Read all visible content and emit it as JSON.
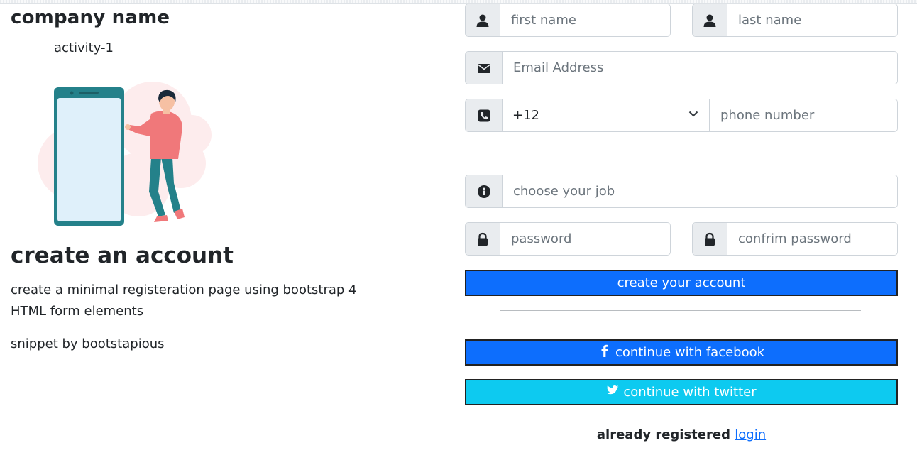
{
  "brand": {
    "company_name": "company name",
    "activity": "activity-1"
  },
  "intro": {
    "heading": "create an account",
    "description": "create a minimal registeration page using bootstrap 4 HTML form elements",
    "credit": "snippet by bootstapious"
  },
  "form": {
    "first_name": {
      "placeholder": "first name",
      "icon": "user-icon"
    },
    "last_name": {
      "placeholder": "last name",
      "icon": "user-icon"
    },
    "email": {
      "placeholder": "Email Address",
      "icon": "envelope-icon"
    },
    "phone": {
      "country_code": "+12",
      "placeholder": "phone number",
      "icon": "phone-icon"
    },
    "job": {
      "placeholder": "choose your job",
      "icon": "info-icon"
    },
    "password": {
      "placeholder": "password",
      "icon": "lock-icon"
    },
    "confirm_password": {
      "placeholder": "confrim password",
      "icon": "lock-icon"
    },
    "submit_label": "create your account",
    "facebook_label": "continue with facebook",
    "twitter_label": "continue with twitter",
    "already_registered": "already registered",
    "login_link": "login"
  },
  "colors": {
    "primary": "#0d6efd",
    "twitter": "#0dcaf0",
    "addon_bg": "#e9ecef"
  }
}
